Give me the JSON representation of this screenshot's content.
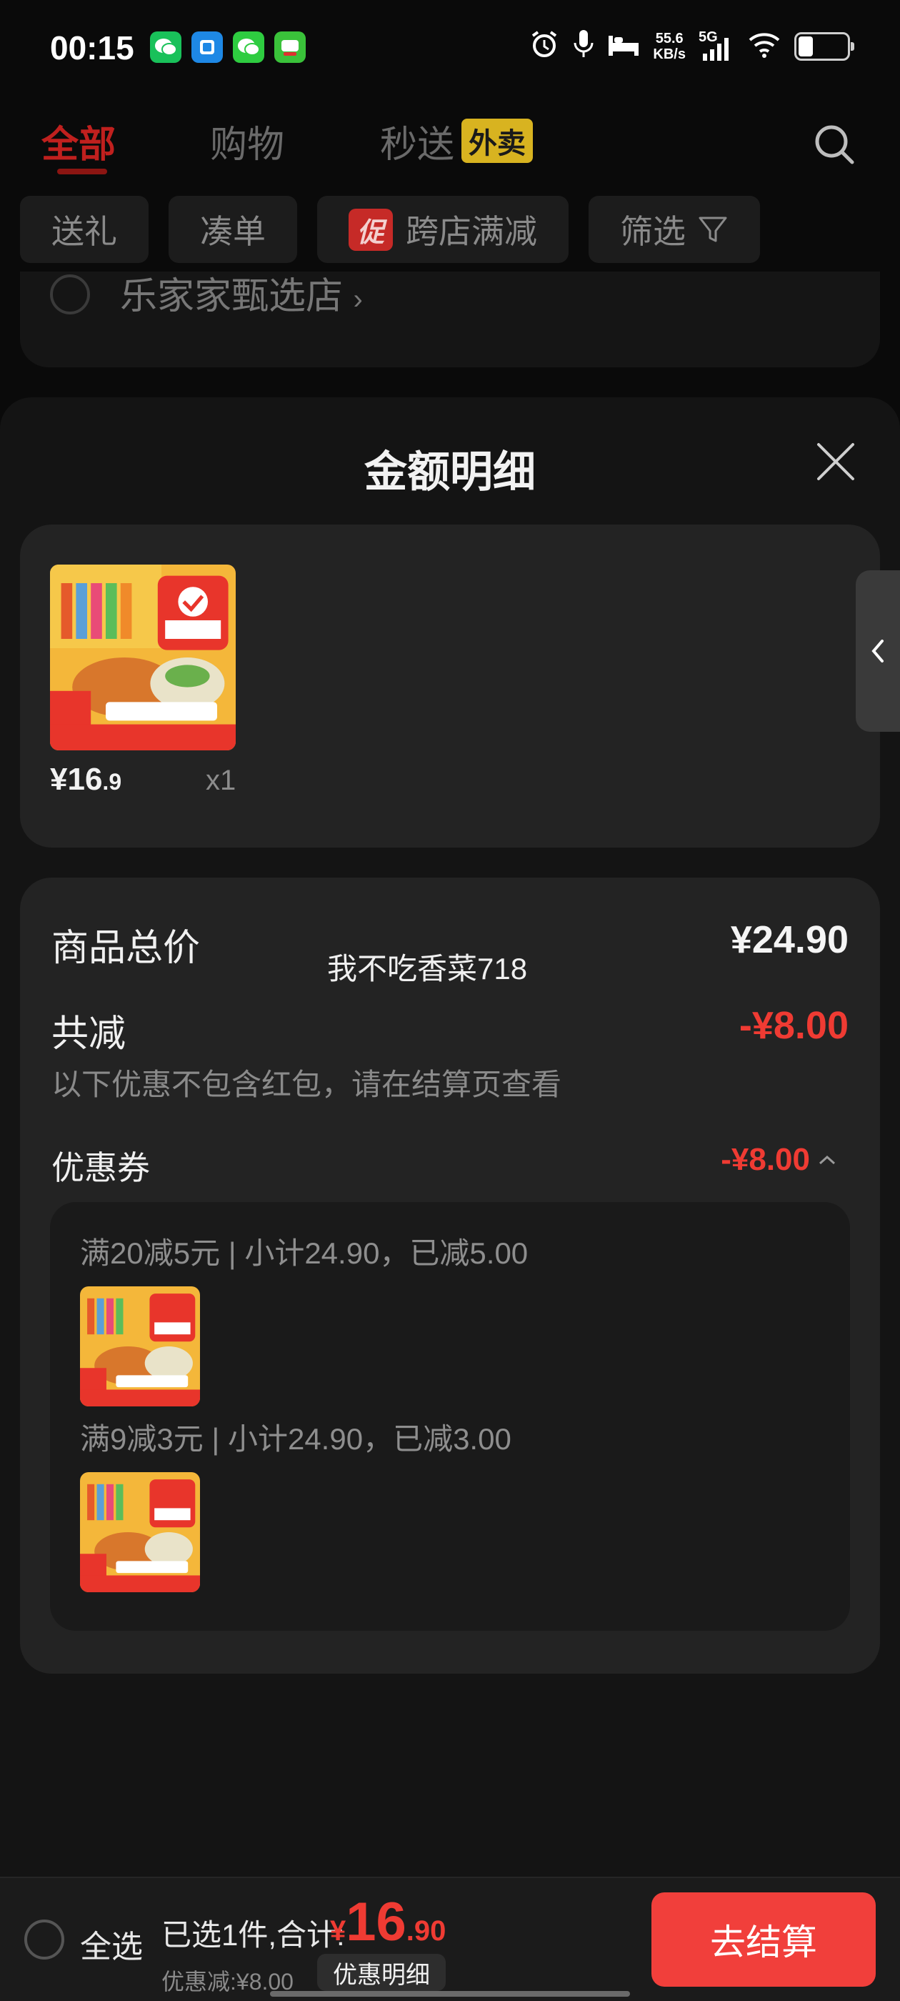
{
  "status_bar": {
    "time": "00:15",
    "net_speed_value": "55.6",
    "net_speed_unit": "KB/s",
    "network": "5G",
    "battery_percent": 30
  },
  "top_tabs": [
    {
      "label": "全部",
      "active": true
    },
    {
      "label": "购物",
      "active": false
    },
    {
      "label": "秒送",
      "badge": "外卖",
      "active": false
    }
  ],
  "filters": [
    {
      "label": "送礼"
    },
    {
      "label": "凑单"
    },
    {
      "label": "跨店满减",
      "tag": "促"
    },
    {
      "label": "筛选"
    }
  ],
  "store": {
    "name": "乐家家甄选店"
  },
  "sheet": {
    "title": "金额明细",
    "product": {
      "image_label": "海洋零食",
      "price_int": "¥16",
      "price_dec": ".9",
      "qty": "x1"
    },
    "details": {
      "total_label": "商品总价",
      "total_value": "¥24.90",
      "watermark": "我不吃香菜718",
      "reduce_label": "共减",
      "reduce_value": "-¥8.00",
      "note": "以下优惠不包含红包，请在结算页查看",
      "coupon_label": "优惠券",
      "coupon_value": "-¥8.00",
      "coupons": [
        {
          "text": "满20减5元 | 小计24.90，已减5.00"
        },
        {
          "text": "满9减3元 | 小计24.90，已减3.00"
        }
      ]
    }
  },
  "bottom_bar": {
    "select_all": "全选",
    "summary": "已选1件,合计:",
    "currency": "¥",
    "total_int": "16",
    "total_dec": ".90",
    "discount": "优惠减:¥8.00",
    "detail_button": "优惠明细",
    "checkout": "去结算"
  },
  "colors": {
    "accent_red": "#ef3b33",
    "active_tab": "#c0201e",
    "badge_yellow": "#d8b320",
    "background": "#0a0a0a"
  }
}
